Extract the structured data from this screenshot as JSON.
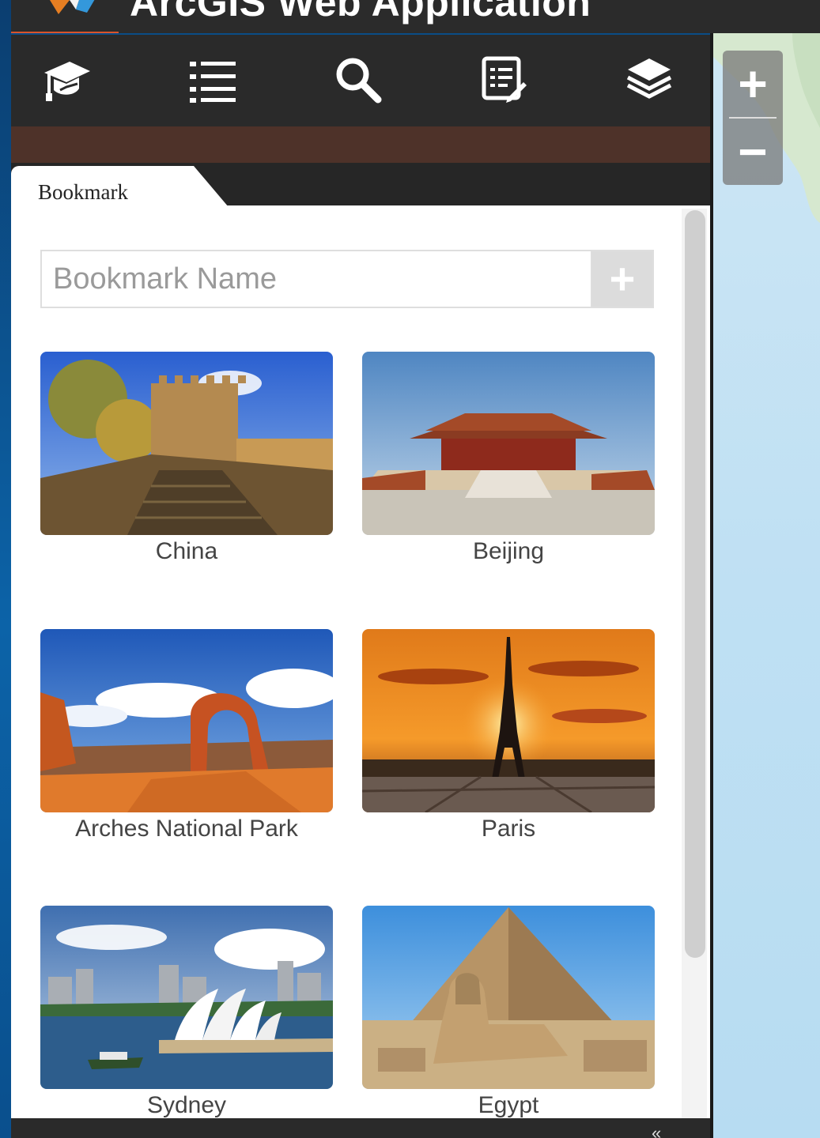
{
  "app": {
    "title": "ArcGIS Web Application"
  },
  "toolbar": {
    "items": [
      {
        "icon": "graduation-cap-icon",
        "name": "About"
      },
      {
        "icon": "legend-list-icon",
        "name": "Legend"
      },
      {
        "icon": "search-icon",
        "name": "Search"
      },
      {
        "icon": "edit-icon",
        "name": "Edit"
      },
      {
        "icon": "layers-icon",
        "name": "Layer List"
      }
    ]
  },
  "panel": {
    "tab_label": "Bookmark",
    "name_input": {
      "placeholder": "Bookmark Name",
      "value": ""
    },
    "add_button_label": "+",
    "bookmarks": [
      {
        "label": "China"
      },
      {
        "label": "Beijing"
      },
      {
        "label": "Arches National Park"
      },
      {
        "label": "Paris"
      },
      {
        "label": "Sydney"
      },
      {
        "label": "Egypt"
      }
    ]
  },
  "map": {
    "zoom_in_label": "+",
    "zoom_out_label": "−"
  },
  "bottom_bar": {
    "collapse_label": "«"
  },
  "colors": {
    "header_bg": "#2a2a2a",
    "accent_band": "#4e3229",
    "title_underline": "#d9542b",
    "panel_bg": "#ffffff",
    "map_water": "#bfe0f3"
  }
}
